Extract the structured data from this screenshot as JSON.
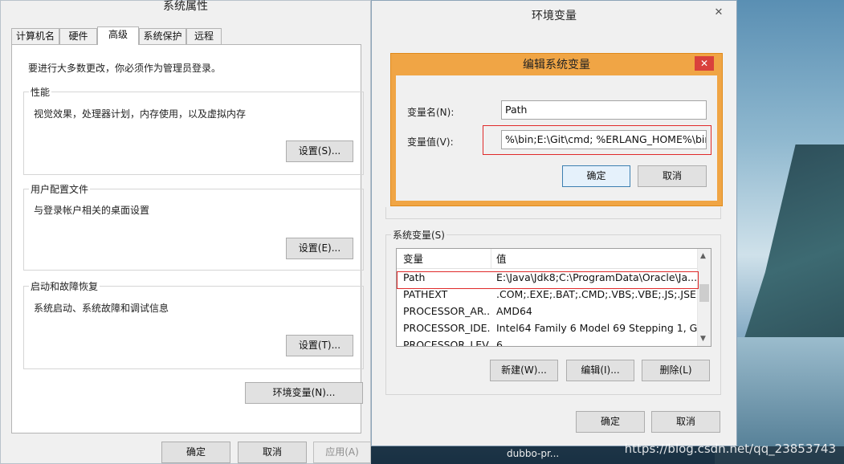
{
  "system_properties": {
    "title": "系统属性",
    "tabs": [
      "计算机名",
      "硬件",
      "高级",
      "系统保护",
      "远程"
    ],
    "admin_note": "要进行大多数更改，你必须作为管理员登录。",
    "performance": {
      "label": "性能",
      "desc": "视觉效果，处理器计划，内存使用，以及虚拟内存",
      "button": "设置(S)..."
    },
    "user_profile": {
      "label": "用户配置文件",
      "desc": "与登录帐户相关的桌面设置",
      "button": "设置(E)..."
    },
    "startup_recovery": {
      "label": "启动和故障恢复",
      "desc": "系统启动、系统故障和调试信息",
      "button": "设置(T)..."
    },
    "env_button": "环境变量(N)...",
    "ok": "确定",
    "cancel": "取消",
    "apply": "应用(A)"
  },
  "environment_variables": {
    "title": "环境变量",
    "system_vars_label": "系统变量(S)",
    "columns": [
      "变量",
      "值"
    ],
    "rows": [
      {
        "name": "Path",
        "value": "E:\\Java\\Jdk8;C:\\ProgramData\\Oracle\\Ja..."
      },
      {
        "name": "PATHEXT",
        "value": ".COM;.EXE;.BAT;.CMD;.VBS;.VBE;.JS;.JSE;...."
      },
      {
        "name": "PROCESSOR_AR...",
        "value": "AMD64"
      },
      {
        "name": "PROCESSOR_IDE...",
        "value": "Intel64 Family 6 Model 69 Stepping 1, G..."
      },
      {
        "name": "PROCESSOR_LEV...",
        "value": "6"
      }
    ],
    "new_button": "新建(W)...",
    "edit_button": "编辑(I)...",
    "delete_button": "删除(L)",
    "ok": "确定",
    "cancel": "取消",
    "close_glyph": "✕"
  },
  "edit_dialog": {
    "title": "编辑系统变量",
    "name_label": "变量名(N):",
    "name_value": "Path",
    "value_label": "变量值(V):",
    "value_value": "%\\bin;E:\\Git\\cmd; %ERLANG_HOME%\\bin;",
    "ok": "确定",
    "cancel": "取消",
    "close_glyph": "✕"
  },
  "taskbar": {
    "watermark": "https://blog.csdn.net/qq_23853743",
    "items": [
      "dubbo-pr..."
    ]
  },
  "colors": {
    "highlight_box": "#e02a2a",
    "edit_dialog_frame": "#f0a545",
    "close_red": "#d9413c"
  }
}
